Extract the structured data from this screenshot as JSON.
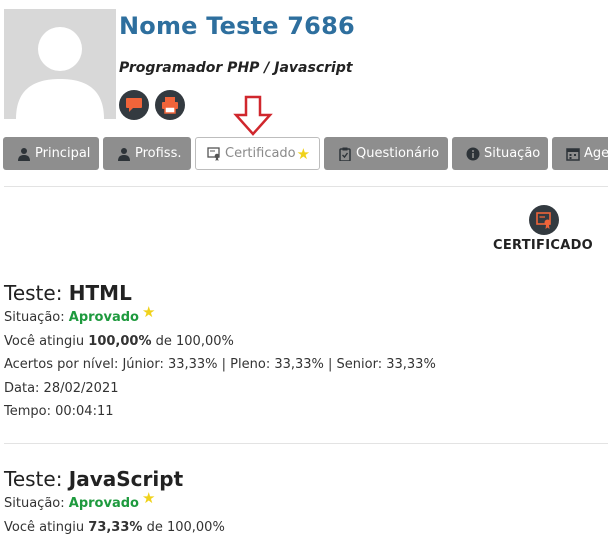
{
  "profile": {
    "name": "Nome Teste 7686",
    "role": "Programador PHP / Javascript"
  },
  "colors": {
    "name": "#2e6f9e",
    "tab_bg": "#8e8e8e",
    "approved": "#1e9a3e",
    "star": "#f0d21b",
    "action_icon": "#f0643a",
    "arrow": "#d0272d"
  },
  "actions": [
    {
      "icon": "chat-icon"
    },
    {
      "icon": "printer-icon"
    }
  ],
  "tabs": [
    {
      "label": "Principal",
      "icon": "user-icon"
    },
    {
      "label": "Profiss.",
      "icon": "user-icon"
    },
    {
      "label": "Certificado",
      "icon": "certificate-icon",
      "active": true,
      "star": "★"
    },
    {
      "label": "Questionário",
      "icon": "clipboard-icon"
    },
    {
      "label": "Situação",
      "icon": "info-icon"
    },
    {
      "label": "Age",
      "icon": "calendar-icon"
    }
  ],
  "certificate": {
    "label": "CERTIFICADO",
    "icon": "certificate-icon"
  },
  "tests": [
    {
      "prefix": "Teste:",
      "name": "HTML",
      "status_label": "Situação:",
      "status": "Aprovado",
      "star": "★",
      "score_prefix": "Você atingiu",
      "score": "100,00%",
      "score_suffix": "de 100,00%",
      "levels": "Acertos por nível: Júnior: 33,33% | Pleno: 33,33% | Senior: 33,33%",
      "date": "Data: 28/02/2021",
      "time": "Tempo: 00:04:11"
    },
    {
      "prefix": "Teste:",
      "name": "JavaScript",
      "status_label": "Situação:",
      "status": "Aprovado",
      "star": "★",
      "score_prefix": "Você atingiu",
      "score": "73,33%",
      "score_suffix": "de 100,00%"
    }
  ]
}
